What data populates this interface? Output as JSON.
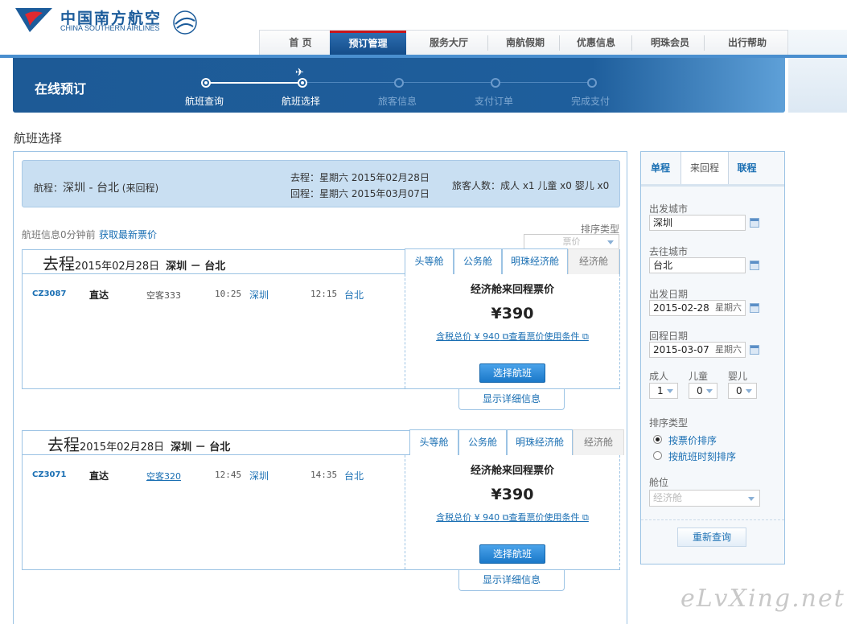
{
  "brand": {
    "name_cn": "中国南方航空",
    "name_en": "CHINA SOUTHERN AIRLINES",
    "skyteam": "SKYTEAM"
  },
  "nav": {
    "items": [
      "首 页",
      "预订管理",
      "服务大厅",
      "南航假期",
      "优惠信息",
      "明珠会员",
      "出行帮助"
    ],
    "active": "预订管理"
  },
  "banner": {
    "title": "在线预订",
    "steps": [
      "航班查询",
      "航班选择",
      "旅客信息",
      "支付订单",
      "完成支付"
    ],
    "current_step": "航班选择"
  },
  "section_title": "航班选择",
  "summary": {
    "route_label": "航程：",
    "route": "深圳 - 台北",
    "trip_type": "(来回程)",
    "depart": "去程：星期六 2015年02月28日",
    "return": "回程：星期六 2015年03月07日",
    "passengers": "旅客人数：成人 x1 儿童 x0 婴儿 x0"
  },
  "refresh": {
    "updated": "航班信息0分钟前",
    "link": "获取最新票价"
  },
  "sort": {
    "label": "排序类型",
    "value": "票价"
  },
  "flights": [
    {
      "dir": "去程",
      "date": "2015年02月28日",
      "route": "深圳 － 台北",
      "tabs": [
        "头等舱",
        "公务舱",
        "明珠经济舱",
        "经济舱"
      ],
      "no": "CZ3087",
      "type": "直达",
      "aircraft": "空客333",
      "dep_time": "10:25",
      "dep_city": "深圳",
      "arr_time": "12:15",
      "arr_city": "台北",
      "price_title": "经济舱来回程票价",
      "price": "¥390",
      "tax_link": "含税总价 ¥ 940",
      "rules_link": "查看票价使用条件",
      "select": "选择航班",
      "detail": "显示详细信息"
    },
    {
      "dir": "去程",
      "date": "2015年02月28日",
      "route": "深圳 － 台北",
      "tabs": [
        "头等舱",
        "公务舱",
        "明珠经济舱",
        "经济舱"
      ],
      "no": "CZ3071",
      "type": "直达",
      "aircraft": "空客320",
      "dep_time": "12:45",
      "dep_city": "深圳",
      "arr_time": "14:35",
      "arr_city": "台北",
      "price_title": "经济舱来回程票价",
      "price": "¥390",
      "tax_link": "含税总价 ¥ 940",
      "rules_link": "查看票价使用条件",
      "select": "选择航班",
      "detail": "显示详细信息"
    }
  ],
  "sidebar": {
    "tabs": [
      "单程",
      "来回程",
      "联程"
    ],
    "active_tab": "来回程",
    "from_label": "出发城市",
    "from": "深圳",
    "to_label": "去往城市",
    "to": "台北",
    "depart_label": "出发日期",
    "depart": "2015-02-28",
    "depart_wd": "星期六",
    "return_label": "回程日期",
    "return": "2015-03-07",
    "return_wd": "星期六",
    "adult_label": "成人",
    "adult": "1",
    "child_label": "儿童",
    "child": "0",
    "infant_label": "婴儿",
    "infant": "0",
    "sort_label": "排序类型",
    "sort_price": "按票价排序",
    "sort_time": "按航班时刻排序",
    "cabin_label": "舱位",
    "cabin": "经济舱",
    "research": "重新查询"
  },
  "watermark": "eLvXing.net"
}
